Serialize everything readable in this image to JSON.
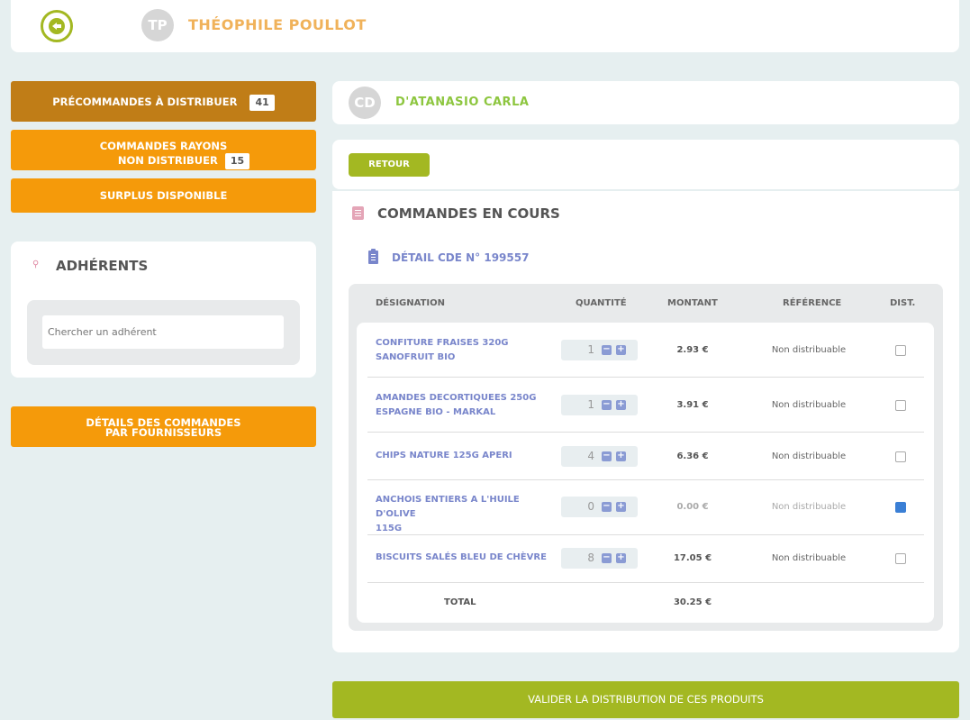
{
  "header": {
    "user_initials": "TP",
    "user_name": "THÉOPHILE POULLOT"
  },
  "menu": {
    "precommandes_label": "PRÉCOMMANDES À DISTRIBUER",
    "precommandes_count": "41",
    "rayons_label_line1": "COMMANDES RAYONS",
    "rayons_label_line2": "NON DISTRIBUER",
    "rayons_count": "15",
    "surplus_label": "SURPLUS DISPONIBLE",
    "details_line1": "DÉTAILS DES COMMANDES",
    "details_line2": "PAR FOURNISSEURS"
  },
  "adherents": {
    "title": "ADHÉRENTS",
    "search_placeholder": "Chercher un adhérent"
  },
  "member": {
    "initials": "CD",
    "name": "D'ATANASIO CARLA"
  },
  "retour_label": "RETOUR",
  "orders": {
    "title": "COMMANDES EN COURS",
    "detail": "DÉTAIL CDE N° 199557",
    "columns": {
      "designation": "DÉSIGNATION",
      "quantite": "QUANTITÉ",
      "montant": "MONTANT",
      "reference": "RÉFÉRENCE",
      "dist": "DIST."
    },
    "rows": [
      {
        "line1": "CONFITURE FRAISES 320G",
        "line2": "SANOFRUIT BIO",
        "qty": "1",
        "amount": "2.93 €",
        "ref": "Non distribuable",
        "checked": false
      },
      {
        "line1": "AMANDES DECORTIQUEES 250G",
        "line2": "ESPAGNE BIO - MARKAL",
        "qty": "1",
        "amount": "3.91 €",
        "ref": "Non distribuable",
        "checked": false
      },
      {
        "line1": "CHIPS NATURE 125G APERI",
        "line2": "",
        "qty": "4",
        "amount": "6.36 €",
        "ref": "Non distribuable",
        "checked": false
      },
      {
        "line1": "ANCHOIS ENTIERS A L'HUILE D'OLIVE",
        "line2": "115G",
        "qty": "0",
        "amount": "0.00 €",
        "ref": "Non distribuable",
        "checked": true
      },
      {
        "line1": "BISCUITS SALÉS BLEU DE CHÈVRE",
        "line2": "",
        "qty": "8",
        "amount": "17.05 €",
        "ref": "Non distribuable",
        "checked": false
      }
    ],
    "total_label": "TOTAL",
    "total_value": "30.25 €"
  },
  "validate_label": "VALIDER LA DISTRIBUTION DE CES PRODUITS",
  "colors": {
    "accent_green": "#a3b822",
    "orange": "#f59a0a",
    "dark_orange": "#c07d17",
    "link_blue": "#7986cb"
  }
}
